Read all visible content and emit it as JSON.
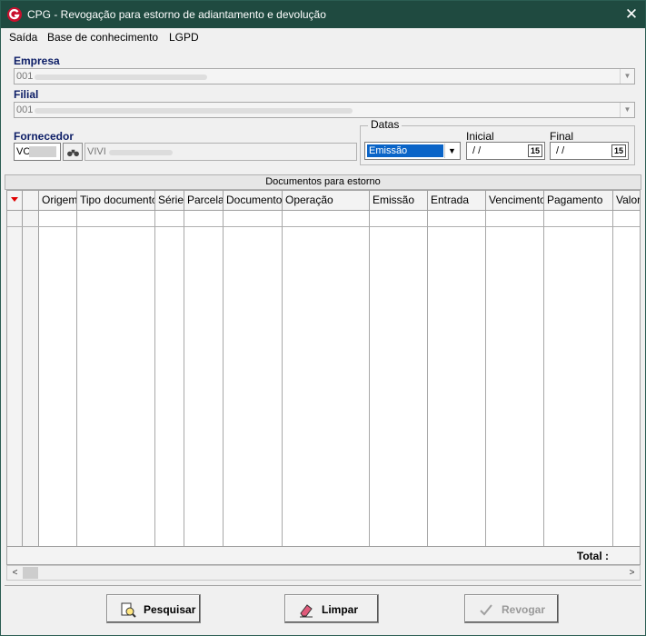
{
  "window": {
    "title": "CPG - Revogação para estorno de adiantamento e devolução",
    "close_glyph": "✕"
  },
  "menu": {
    "items": [
      "Saída",
      "Base de conhecimento",
      "LGPD"
    ]
  },
  "empresa": {
    "label": "Empresa",
    "code": "001"
  },
  "filial": {
    "label": "Filial",
    "code": "001"
  },
  "fornecedor": {
    "label": "Fornecedor",
    "code": "VC",
    "name": "VIVI"
  },
  "datas": {
    "group_label": "Datas",
    "type_value": "Emissão",
    "inicial_label": "Inicial",
    "inicial_value": "/ /",
    "final_label": "Final",
    "final_value": "/ /",
    "calendar_glyph": "15"
  },
  "grid": {
    "caption": "Documentos para estorno",
    "columns": [
      "Origem",
      "Tipo documento",
      "Série",
      "Parcela",
      "Documento",
      "Operação",
      "Emissão",
      "Entrada",
      "Vencimento",
      "Pagamento",
      "Valor"
    ],
    "total_label": "Total :"
  },
  "buttons": {
    "pesquisar": "Pesquisar",
    "limpar": "Limpar",
    "revogar": "Revogar"
  },
  "colors": {
    "titlebar": "#1f4a40",
    "label_blue": "#0c1d66",
    "selection": "#0a64c7",
    "sort_arrow": "#e00000"
  },
  "icons": {
    "app": "app-logo-icon",
    "search": "binoculars-icon",
    "pesquisar": "search-document-icon",
    "limpar": "eraser-icon",
    "revogar": "checkmark-icon"
  }
}
